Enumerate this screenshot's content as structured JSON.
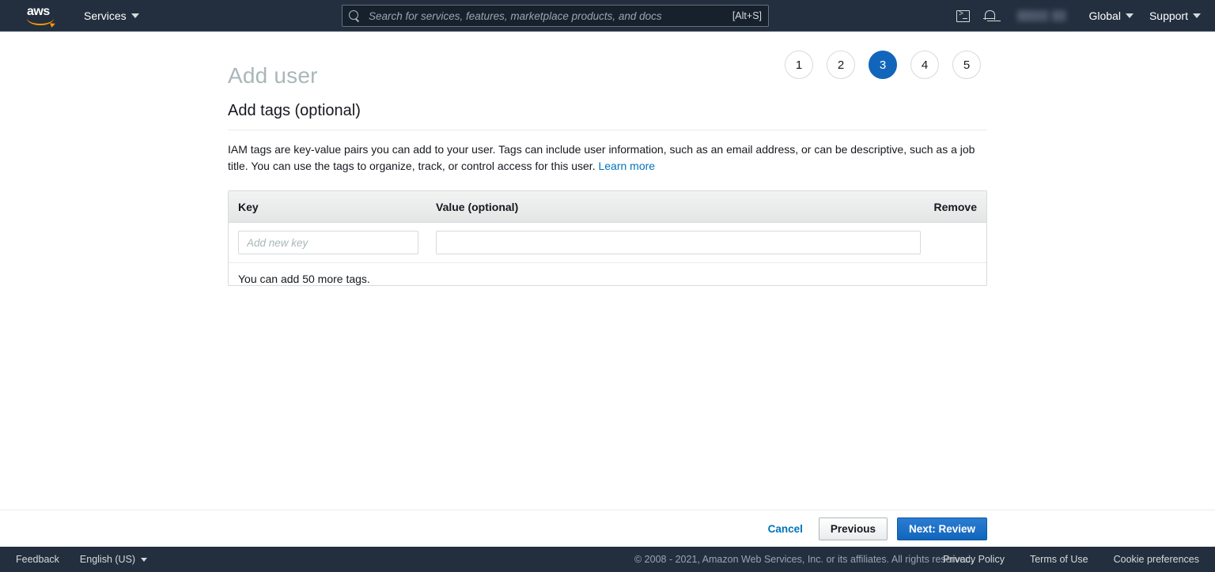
{
  "topnav": {
    "logo_alt": "aws",
    "services_label": "Services",
    "search": {
      "placeholder": "Search for services, features, marketplace products, and docs",
      "value": "",
      "shortcut": "[Alt+S]"
    },
    "cloudshell_icon": "terminal-icon",
    "notifications_icon": "bell-icon",
    "account_label": "",
    "region_label": "Global",
    "support_label": "Support"
  },
  "page": {
    "title": "Add user",
    "steps": [
      {
        "number": "1",
        "active": false
      },
      {
        "number": "2",
        "active": false
      },
      {
        "number": "3",
        "active": true
      },
      {
        "number": "4",
        "active": false
      },
      {
        "number": "5",
        "active": false
      }
    ]
  },
  "section": {
    "heading": "Add tags (optional)",
    "description": "IAM tags are key-value pairs you can add to your user. Tags can include user information, such as an email address, or can be descriptive, such as a job title. You can use the tags to organize, track, or control access for this user.",
    "learn_more_label": "Learn more"
  },
  "tags_table": {
    "columns": {
      "key": "Key",
      "value": "Value (optional)",
      "remove": "Remove"
    },
    "rows": [
      {
        "key_value": "",
        "key_placeholder": "Add new key",
        "value_value": "",
        "value_placeholder": ""
      }
    ],
    "note": "You can add 50 more tags."
  },
  "actions": {
    "cancel_label": "Cancel",
    "previous_label": "Previous",
    "next_label": "Next: Review"
  },
  "footer": {
    "feedback_label": "Feedback",
    "language_label": "English (US)",
    "copyright": "© 2008 - 2021, Amazon Web Services, Inc. or its affiliates. All rights reserved.",
    "privacy_label": "Privacy Policy",
    "terms_label": "Terms of Use",
    "cookies_label": "Cookie preferences"
  },
  "colors": {
    "nav_bg": "#232f3e",
    "accent_blue": "#1166bb",
    "link_blue": "#0073bb",
    "logo_orange": "#ff9900",
    "title_gray": "#aab7b8"
  }
}
